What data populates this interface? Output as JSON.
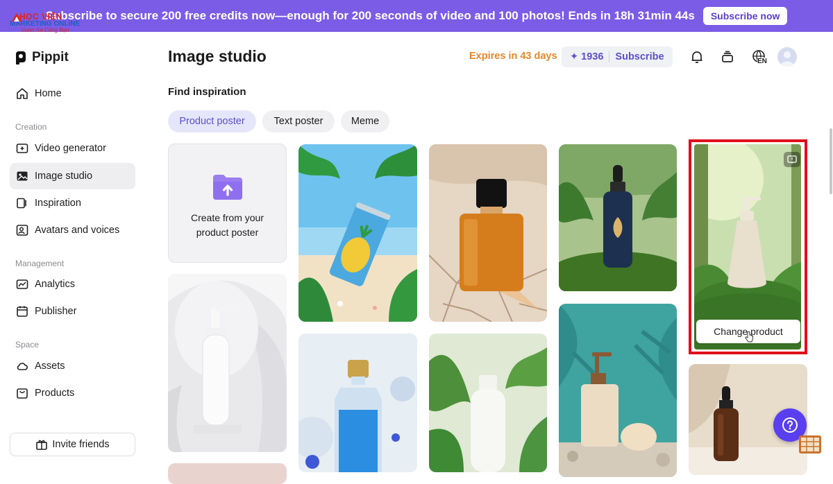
{
  "banner": {
    "message": "Subscribe to secure 200 free credits now—enough for 200 seconds of video and 100 photos! Ends in 18h 31min 44s",
    "button_label": "Subscribe now"
  },
  "watermark": {
    "line1": "HỌC VIỆN",
    "line2": "MARKETING ONLINE",
    "line3": "Vươn Xa Cùng Bạn"
  },
  "brand": {
    "name": "Pippit"
  },
  "sidebar": {
    "home": "Home",
    "sections": {
      "creation": "Creation",
      "management": "Management",
      "space": "Space"
    },
    "items": [
      {
        "label": "Video generator",
        "icon": "video-add-icon"
      },
      {
        "label": "Image studio",
        "icon": "image-studio-icon"
      },
      {
        "label": "Inspiration",
        "icon": "inspiration-icon"
      },
      {
        "label": "Avatars and voices",
        "icon": "avatar-icon"
      },
      {
        "label": "Analytics",
        "icon": "analytics-icon"
      },
      {
        "label": "Publisher",
        "icon": "calendar-icon"
      },
      {
        "label": "Assets",
        "icon": "cloud-icon"
      },
      {
        "label": "Products",
        "icon": "product-icon"
      }
    ],
    "invite_label": "Invite friends"
  },
  "header": {
    "title": "Image studio",
    "expires": "Expires in 43 days",
    "credits": "1936",
    "subscribe": "Subscribe",
    "language": "EN"
  },
  "main": {
    "section_title": "Find inspiration",
    "chips": [
      "Product poster",
      "Text poster",
      "Meme"
    ],
    "active_chip": "Product poster",
    "create_card_text": "Create from your product poster",
    "change_product_label": "Change product"
  },
  "colors": {
    "accent": "#7b5ce6",
    "credit_text": "#5b4fcf",
    "expires_text": "#e8872a",
    "highlight": "#e0101a"
  }
}
